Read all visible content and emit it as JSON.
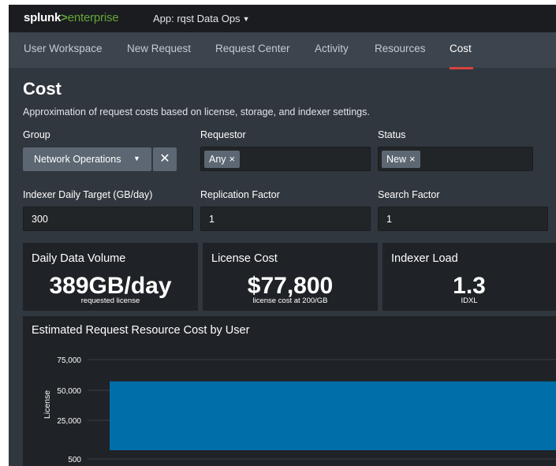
{
  "header": {
    "logo_brand": "splunk",
    "logo_gt": ">",
    "logo_product": "enterprise",
    "app_selector": "App: rqst Data Ops"
  },
  "nav": {
    "items": [
      "User Workspace",
      "New Request",
      "Request Center",
      "Activity",
      "Resources",
      "Cost"
    ],
    "active": "Cost"
  },
  "page": {
    "title": "Cost",
    "description": "Approximation of request costs based on license, storage, and indexer settings."
  },
  "filters": {
    "group": {
      "label": "Group",
      "value": "Network Operations",
      "clear_symbol": "✕"
    },
    "requestor": {
      "label": "Requestor",
      "token": "Any"
    },
    "status": {
      "label": "Status",
      "token": "New"
    },
    "token_remove_symbol": "×",
    "indexer_target": {
      "label": "Indexer Daily Target (GB/day)",
      "value": "300"
    },
    "replication_factor": {
      "label": "Replication Factor",
      "value": "1"
    },
    "search_factor": {
      "label": "Search Factor",
      "value": "1"
    }
  },
  "kpis": [
    {
      "title": "Daily Data Volume",
      "value": "389GB/day",
      "caption": "requested license"
    },
    {
      "title": "License Cost",
      "value": "$77,800",
      "caption": "license cost at 200/GB"
    },
    {
      "title": "Indexer Load",
      "value": "1.3",
      "caption": "IDXL"
    }
  ],
  "chart_data": {
    "type": "bar",
    "title": "Estimated Request Resource Cost by User",
    "ylabel": "License",
    "xlabel": "",
    "y_ticks": [
      "75,000",
      "50,000",
      "25,000",
      "500"
    ],
    "series": [
      {
        "values": [
          57000
        ],
        "color": "#006ea8"
      }
    ],
    "ylim": [
      0,
      75000
    ],
    "grid": true
  },
  "colors": {
    "accent_green": "#65a637",
    "active_tab_underline": "#d6433b",
    "bar": "#006ea8"
  }
}
